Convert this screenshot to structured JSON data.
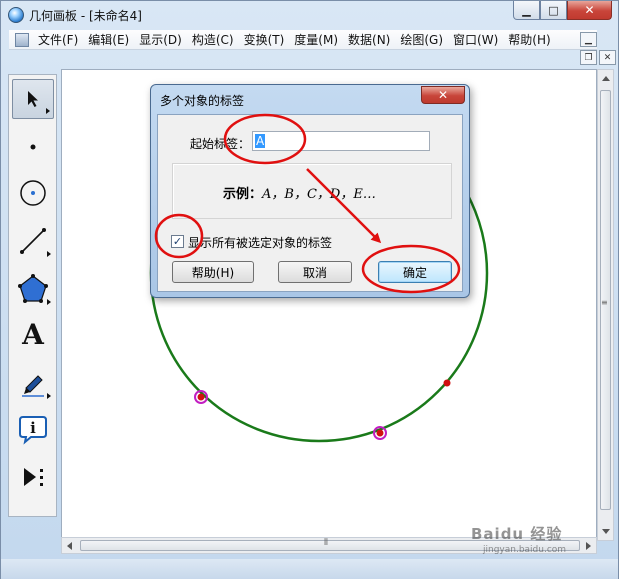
{
  "window": {
    "title": "几何画板 - [未命名4]",
    "minimize_glyph": "▁",
    "maximize_glyph": "□",
    "close_glyph": "✕"
  },
  "menubar": {
    "items": [
      "文件(F)",
      "编辑(E)",
      "显示(D)",
      "构造(C)",
      "变换(T)",
      "度量(M)",
      "数据(N)",
      "绘图(G)",
      "窗口(W)",
      "帮助(H)"
    ],
    "mdi_minimize_glyph": "▁",
    "mdi_restore_glyph": "❐",
    "mdi_close_glyph": "✕"
  },
  "toolbox": {
    "tools": [
      {
        "name": "arrow-select-icon",
        "active": true
      },
      {
        "name": "point-tool-icon"
      },
      {
        "name": "compass-tool-icon"
      },
      {
        "name": "straightedge-tool-icon"
      },
      {
        "name": "polygon-tool-icon"
      },
      {
        "name": "text-tool-icon",
        "glyph": "A"
      },
      {
        "name": "marker-tool-icon"
      },
      {
        "name": "information-tool-icon"
      },
      {
        "name": "custom-tool-icon"
      }
    ]
  },
  "geometry": {
    "circle_color": "#1a7a1a",
    "point_color": "#d01010",
    "selection_color": "#c21ec2"
  },
  "dialog": {
    "title": "多个对象的标签",
    "close_glyph": "✕",
    "start_label_text": "起始标签：",
    "start_label_value": "A",
    "example_prefix": "示例：",
    "example_labels": "A，B，C，D，E…",
    "checkbox_checked": true,
    "checkbox_mark": "✓",
    "checkbox_label": "显示所有被选定对象的标签",
    "help_button": "帮助(H)",
    "cancel_button": "取消",
    "ok_button": "确定"
  },
  "annotation_color": "#e01010",
  "watermark": {
    "main": "Baidu 经验",
    "sub": "jingyan.baidu.com"
  }
}
